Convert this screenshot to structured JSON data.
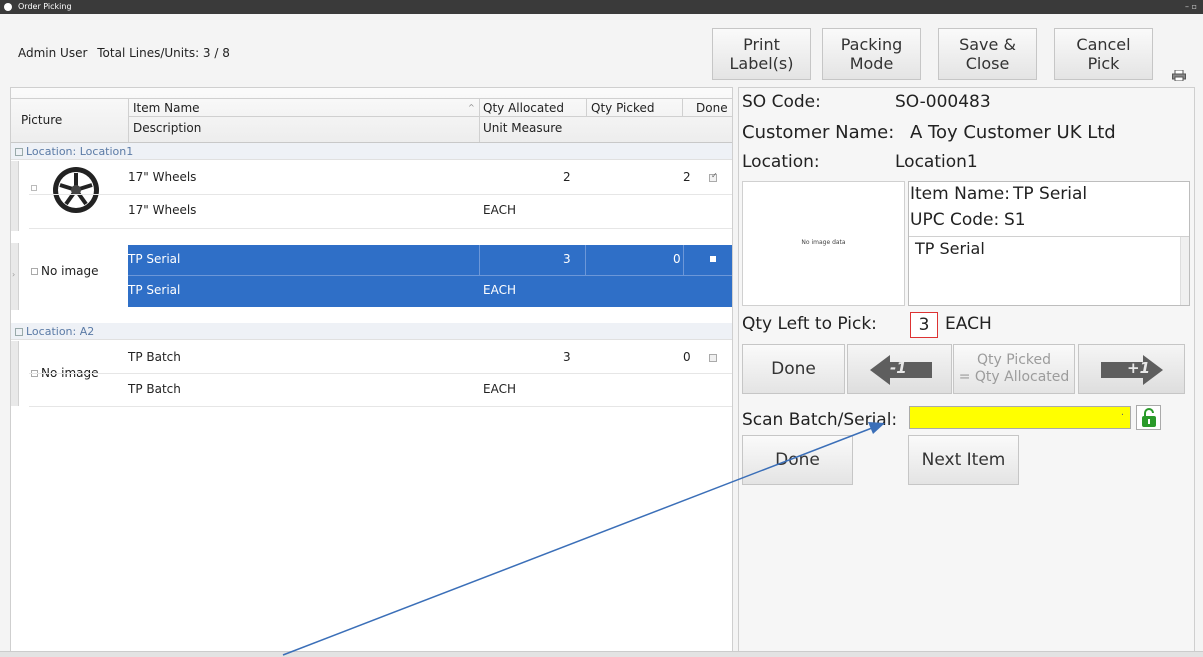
{
  "window": {
    "title": "Order Picking",
    "icon": "info-icon"
  },
  "header": {
    "user": "Admin User",
    "totals": "Total Lines/Units: 3 / 8"
  },
  "toolbar": {
    "print_labels": "Print\nLabel(s)",
    "packing_mode": "Packing\nMode",
    "save_close": "Save &\nClose",
    "cancel_pick": "Cancel\nPick"
  },
  "grid": {
    "columns": {
      "picture": "Picture",
      "item_name": "Item Name",
      "description": "Description",
      "qty_allocated": "Qty Allocated",
      "unit_measure": "Unit Measure",
      "qty_picked": "Qty Picked",
      "done": "Done"
    },
    "groups": [
      {
        "label": "Location: Location1",
        "rows": [
          {
            "picture": "wheel-icon",
            "item_name": "17\" Wheels",
            "description": "17\" Wheels",
            "qty_allocated": "2",
            "unit_measure": "EACH",
            "qty_picked": "2",
            "done": true
          },
          {
            "picture": "No image",
            "item_name": "TP Serial",
            "description": "TP Serial",
            "qty_allocated": "3",
            "unit_measure": "EACH",
            "qty_picked": "0",
            "done": false,
            "selected": true
          }
        ]
      },
      {
        "label": "Location: A2",
        "rows": [
          {
            "picture": "No image",
            "item_name": "TP Batch",
            "description": "TP Batch",
            "qty_allocated": "3",
            "unit_measure": "EACH",
            "qty_picked": "0",
            "done": false
          }
        ]
      }
    ]
  },
  "detail": {
    "so_code_label": "SO Code:",
    "so_code": "SO-000483",
    "customer_label": "Customer Name:",
    "customer": "A Toy Customer UK Ltd",
    "location_label": "Location:",
    "location": "Location1",
    "no_image_text": "No image data",
    "item_name_label": "Item Name:",
    "item_name": "TP Serial",
    "upc_label": "UPC Code:",
    "upc": "S1",
    "description": "TP Serial",
    "qty_left_label": "Qty Left to Pick:",
    "qty_left": "3",
    "qty_left_unit": "EACH",
    "done_label": "Done",
    "minus_label": "-1",
    "qty_picked_eq_line1": "Qty Picked",
    "qty_picked_eq_line2": "= Qty Allocated",
    "plus_label": "+1",
    "scan_label": "Scan Batch/Serial:",
    "scan_value": "",
    "done2_label": "Done",
    "next_item_label": "Next Item"
  },
  "colors": {
    "selection": "#2f6fc7",
    "scan_field": "#ffff00",
    "lock": "#2a9a2a",
    "annotation": "#3b6fb8",
    "qty_border": "#d33333"
  }
}
